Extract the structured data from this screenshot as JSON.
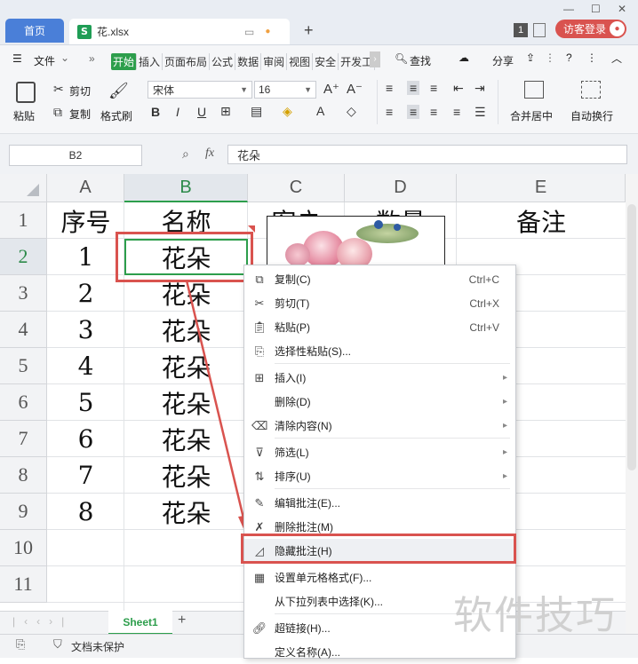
{
  "titlebar": {
    "home_tab": "首页",
    "file_tab": "花.xlsx",
    "file_icon": "S",
    "badge": "1",
    "login": "访客登录",
    "new_tab": "+"
  },
  "menubar": {
    "file": "文件",
    "tabs": [
      "开始",
      "插入",
      "页面布局",
      "公式",
      "数据",
      "审阅",
      "视图",
      "安全",
      "开发工"
    ],
    "find": "查找",
    "share": "分享"
  },
  "ribbon": {
    "paste": "粘贴",
    "cut": "剪切",
    "copy": "复制",
    "format_painter": "格式刷",
    "font_name": "宋体",
    "font_size": "16",
    "merge": "合并居中",
    "wrap": "自动换行"
  },
  "formula": {
    "cell_ref": "B2",
    "fx": "fx",
    "value": "花朵"
  },
  "sheet": {
    "columns": [
      "A",
      "B",
      "C",
      "D",
      "E"
    ],
    "rows": [
      "1",
      "2",
      "3",
      "4",
      "5",
      "6",
      "7",
      "8",
      "9",
      "10",
      "11"
    ],
    "header_row": [
      "序号",
      "名称",
      "客户",
      "数量",
      "备注"
    ],
    "col_a": [
      "1",
      "2",
      "3",
      "4",
      "5",
      "6",
      "7",
      "8"
    ],
    "col_b": [
      "花朵",
      "花朵",
      "花朵",
      "花朵",
      "花朵",
      "花朵",
      "花朵",
      "花朵"
    ],
    "sheet_tab": "Sheet1",
    "status": "文档未保护"
  },
  "context_menu": [
    {
      "label": "复制(C)",
      "shortcut": "Ctrl+C",
      "icon": "copy-icon"
    },
    {
      "label": "剪切(T)",
      "shortcut": "Ctrl+X",
      "icon": "scissors-icon"
    },
    {
      "label": "粘贴(P)",
      "shortcut": "Ctrl+V",
      "icon": "paste-icon"
    },
    {
      "label": "选择性粘贴(S)...",
      "shortcut": "",
      "icon": "paste-special-icon"
    },
    {
      "label": "插入(I)",
      "shortcut": "",
      "icon": "insert-icon"
    },
    {
      "label": "删除(D)",
      "shortcut": "",
      "icon": ""
    },
    {
      "label": "清除内容(N)",
      "shortcut": "",
      "icon": "eraser-icon"
    },
    {
      "label": "筛选(L)",
      "shortcut": "",
      "icon": "filter-icon"
    },
    {
      "label": "排序(U)",
      "shortcut": "",
      "icon": "sort-icon"
    },
    {
      "label": "编辑批注(E)...",
      "shortcut": "",
      "icon": "edit-comment-icon"
    },
    {
      "label": "删除批注(M)",
      "shortcut": "",
      "icon": "delete-comment-icon"
    },
    {
      "label": "隐藏批注(H)",
      "shortcut": "",
      "icon": "hide-comment-icon"
    },
    {
      "label": "设置单元格格式(F)...",
      "shortcut": "",
      "icon": "format-cells-icon"
    },
    {
      "label": "从下拉列表中选择(K)...",
      "shortcut": "",
      "icon": ""
    },
    {
      "label": "超链接(H)...",
      "shortcut": "",
      "icon": "link-icon"
    },
    {
      "label": "定义名称(A)...",
      "shortcut": "",
      "icon": ""
    }
  ],
  "watermark": "软件技巧",
  "colors": {
    "accent": "#2d9e4c",
    "highlight": "#d9534f",
    "home_tab": "#4a7fd8"
  }
}
